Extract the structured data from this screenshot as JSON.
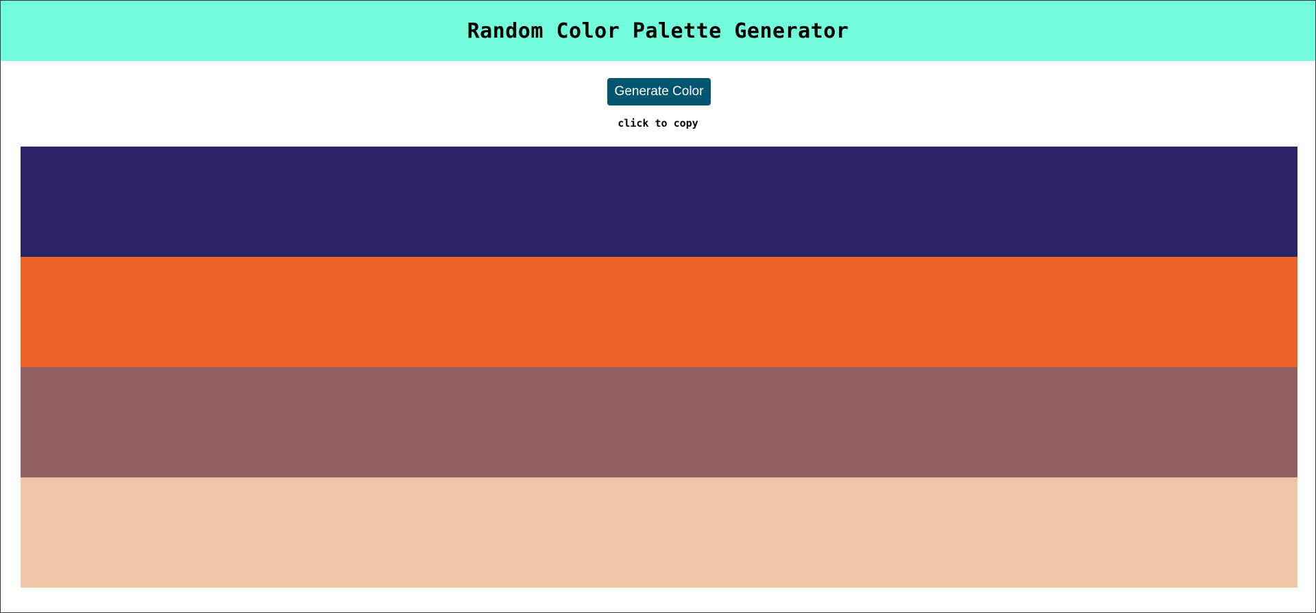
{
  "header": {
    "title": "Random Color Palette Generator",
    "background": "#73fcdc"
  },
  "controls": {
    "generate_label": "Generate Color",
    "button_color": "#01556f",
    "copy_hint": "click to copy"
  },
  "palette": {
    "swatches": [
      {
        "color": "#2a2467"
      },
      {
        "color": "#eb6329"
      },
      {
        "color": "#8f5f63"
      },
      {
        "color": "#eec8a6"
      }
    ]
  }
}
